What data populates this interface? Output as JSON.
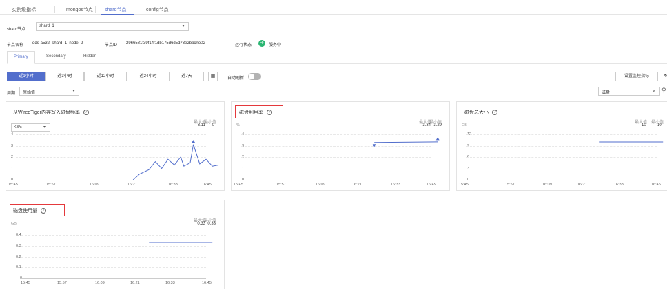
{
  "top_tabs": [
    "实例级指标",
    "mongos节点",
    "shard节点",
    "config节点"
  ],
  "shard_select": {
    "label": "shard节点",
    "value": "shard_1"
  },
  "node_info": {
    "name_label": "节点名称",
    "name_value": "dds-a532_shard_1_node_2",
    "id_label": "节点ID",
    "id_value": "2966581f39f14f1db175d6d5d73e2bbcno02",
    "status_label": "运行状态",
    "status_value": "服务中"
  },
  "sub_tabs": [
    "Primary",
    "Secondary",
    "Hidden"
  ],
  "period_buttons": [
    "近1小时",
    "近3小时",
    "近12小时",
    "近24小时",
    "近7天"
  ],
  "auto_refresh_label": "自动刷新",
  "cycle": {
    "label": "周期",
    "value": "原始值"
  },
  "set_metrics_button": "设置监控指标",
  "search": {
    "value": "磁盘"
  },
  "panels": [
    {
      "title": "从WiredTiger内存写入磁盘频率",
      "unit_select": "KB/s",
      "max_label": "最大值",
      "min_label": "最小值",
      "max_value": "3.11",
      "min_value": "0",
      "y_ticks": [
        "4",
        "3",
        "2",
        "1",
        "0"
      ],
      "x_ticks": [
        "15:45",
        "15:57",
        "16:09",
        "16:21",
        "16:33",
        "16:45"
      ]
    },
    {
      "title": "磁盘利用率",
      "unit": "%",
      "max_label": "最大值",
      "min_label": "最小值",
      "max_value": "3.34",
      "min_value": "3.29",
      "y_ticks": [
        "4",
        "3",
        "2",
        "1",
        "0"
      ],
      "x_ticks": [
        "15:45",
        "15:57",
        "16:09",
        "16:21",
        "16:33",
        "16:45"
      ]
    },
    {
      "title": "磁盘总大小",
      "unit": "GB",
      "max_label": "最大值",
      "min_label": "最小值",
      "max_value": "10",
      "min_value": "10",
      "y_ticks": [
        "12",
        "9",
        "6",
        "3",
        "0"
      ],
      "x_ticks": [
        "15:45",
        "15:57",
        "16:09",
        "16:21",
        "16:33",
        "16:45"
      ]
    },
    {
      "title": "磁盘使用量",
      "unit": "GB",
      "max_label": "最大值",
      "min_label": "最小值",
      "max_value": "0.33",
      "min_value": "0.33",
      "y_ticks": [
        "0.4",
        "0.3",
        "0.2",
        "0.1",
        "0"
      ],
      "x_ticks": [
        "15:45",
        "15:57",
        "16:09",
        "16:21",
        "16:33",
        "16:45"
      ]
    }
  ],
  "chart_data": [
    {
      "type": "line",
      "ylim": [
        0,
        4
      ],
      "series": [
        {
          "values": [
            [
              16.22,
              0.0
            ],
            [
              16.24,
              0.5
            ],
            [
              16.27,
              0.9
            ],
            [
              16.29,
              1.6
            ],
            [
              16.31,
              1.0
            ],
            [
              16.33,
              1.8
            ],
            [
              16.35,
              1.3
            ],
            [
              16.37,
              2.0
            ],
            [
              16.38,
              1.2
            ],
            [
              16.4,
              1.5
            ],
            [
              16.41,
              3.11
            ],
            [
              16.43,
              1.4
            ],
            [
              16.45,
              1.8
            ],
            [
              16.47,
              1.2
            ],
            [
              16.49,
              1.3
            ]
          ]
        }
      ]
    },
    {
      "type": "line",
      "ylim": [
        0,
        4
      ],
      "series": [
        {
          "values": [
            [
              16.27,
              3.29
            ],
            [
              16.47,
              3.34
            ]
          ]
        }
      ]
    },
    {
      "type": "line",
      "ylim": [
        0,
        12
      ],
      "series": [
        {
          "values": [
            [
              16.27,
              10
            ],
            [
              16.47,
              10
            ]
          ]
        }
      ]
    },
    {
      "type": "line",
      "ylim": [
        0,
        0.4
      ],
      "series": [
        {
          "values": [
            [
              16.27,
              0.33
            ],
            [
              16.47,
              0.33
            ]
          ]
        }
      ]
    }
  ],
  "colors": {
    "accent": "#526ecc",
    "status_ok": "#2bb673",
    "highlight": "#e4393c"
  }
}
